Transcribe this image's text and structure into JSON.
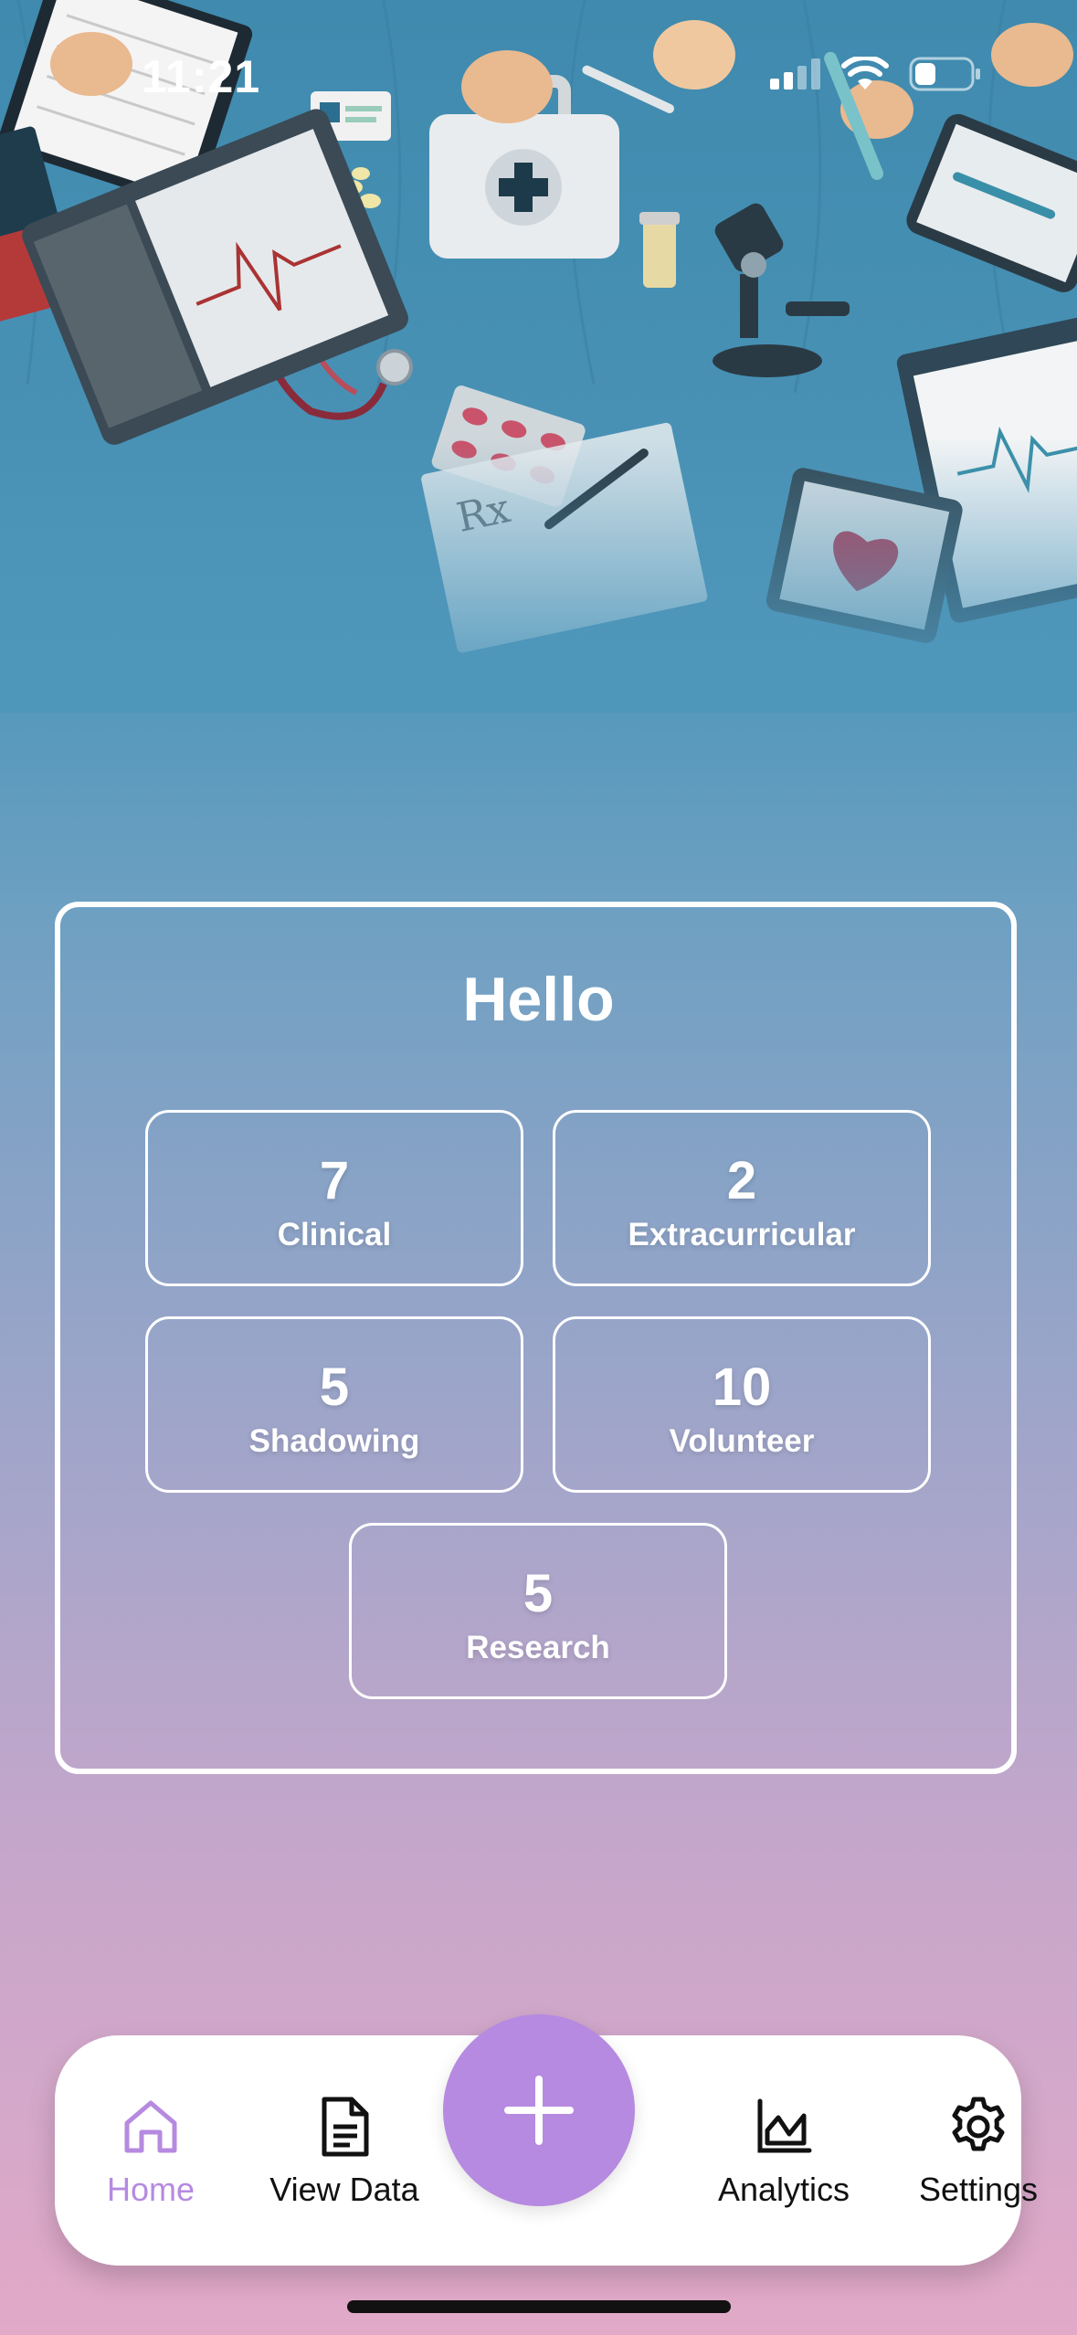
{
  "status_bar": {
    "time": "11:21"
  },
  "greeting": "Hello",
  "stats": [
    {
      "count": "7",
      "label": "Clinical"
    },
    {
      "count": "2",
      "label": "Extracurricular"
    },
    {
      "count": "5",
      "label": "Shadowing"
    },
    {
      "count": "10",
      "label": "Volunteer"
    },
    {
      "count": "5",
      "label": "Research"
    }
  ],
  "tab_bar": {
    "items": [
      {
        "label": "Home",
        "icon": "home-icon",
        "active": true
      },
      {
        "label": "View Data",
        "icon": "document-icon"
      },
      {
        "label": "Analytics",
        "icon": "chart-icon"
      },
      {
        "label": "Settings",
        "icon": "gear-icon"
      }
    ],
    "fab_icon": "plus-icon"
  },
  "colors": {
    "accent": "#b68ae0",
    "background_top": "#4a93b6",
    "background_bottom": "#e2a9c8",
    "card_border": "#ffffff"
  }
}
